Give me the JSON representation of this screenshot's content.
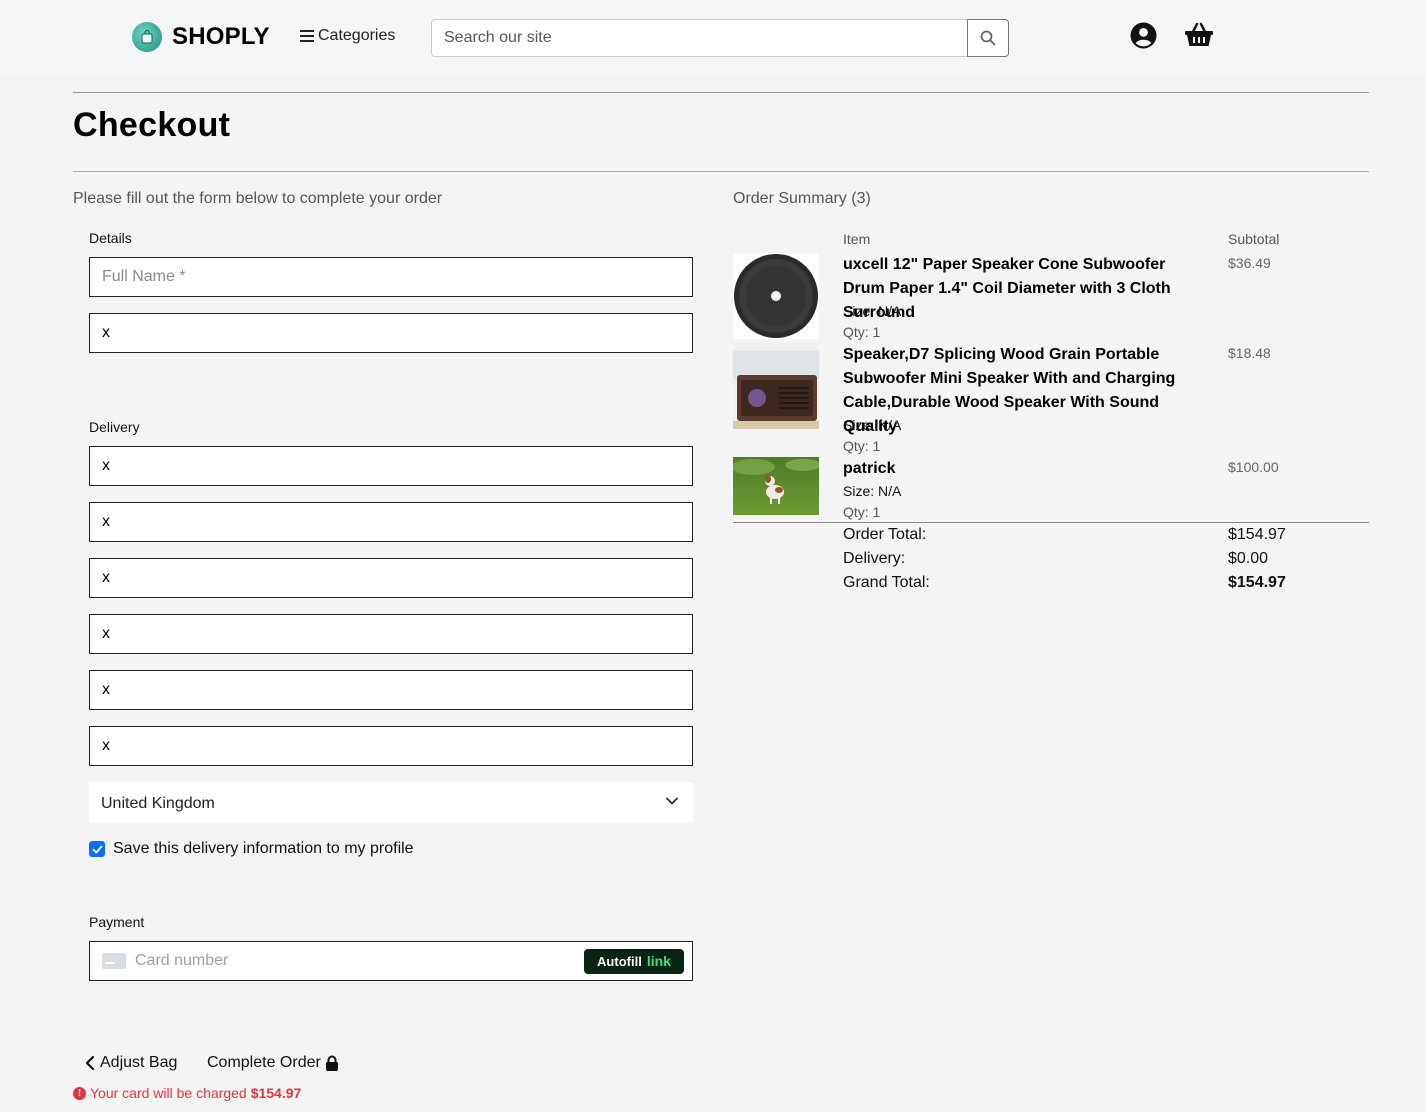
{
  "header": {
    "logo_text": "SHOPLY",
    "categories_label": "Categories",
    "search_placeholder": "Search our site"
  },
  "page": {
    "title": "Checkout",
    "intro": "Please fill out the form below to complete your order"
  },
  "details": {
    "label": "Details",
    "full_name_placeholder": "Full Name *",
    "email_value": "x"
  },
  "delivery": {
    "label": "Delivery",
    "fields": [
      "x",
      "x",
      "x",
      "x",
      "x",
      "x"
    ],
    "country": "United Kingdom",
    "save_label": "Save this delivery information to my profile",
    "save_checked": true
  },
  "payment": {
    "label": "Payment",
    "card_placeholder": "Card number",
    "autofill_label": "Autofill",
    "autofill_link": "link"
  },
  "actions": {
    "adjust_bag": "Adjust Bag",
    "complete_order": "Complete Order",
    "charge_text": "Your card will be charged",
    "charge_amount": "$154.97"
  },
  "summary": {
    "title": "Order Summary (3)",
    "col_item": "Item",
    "col_subtotal": "Subtotal",
    "items": [
      {
        "name": "uxcell 12\" Paper Speaker Cone Subwoofer Drum Paper 1.4\" Coil Diameter with 3 Cloth Surround",
        "size": "Size: N/A",
        "qty": "Qty: 1",
        "price": "$36.49"
      },
      {
        "name": "Speaker,D7 Splicing Wood Grain Portable Subwoofer Mini Speaker With and Charging Cable,Durable Wood Speaker With Sound Quality",
        "size": "Size: N/A",
        "qty": "Qty: 1",
        "price": "$18.48"
      },
      {
        "name": "patrick",
        "size": "Size: N/A",
        "qty": "Qty: 1",
        "price": "$100.00"
      }
    ],
    "order_total_label": "Order Total:",
    "order_total": "$154.97",
    "delivery_label": "Delivery:",
    "delivery": "$0.00",
    "grand_total_label": "Grand Total:",
    "grand_total": "$154.97"
  },
  "icons": {
    "search": "search-icon",
    "account": "account-icon",
    "basket": "basket-icon",
    "menu": "hamburger-icon",
    "lock": "lock-icon",
    "chevron_left": "chevron-left-icon",
    "chevron_down": "chevron-down-icon",
    "alert": "alert-icon"
  },
  "colors": {
    "accent": "#0d6efd",
    "error": "#dc3545",
    "link_green": "#3ee07a"
  }
}
